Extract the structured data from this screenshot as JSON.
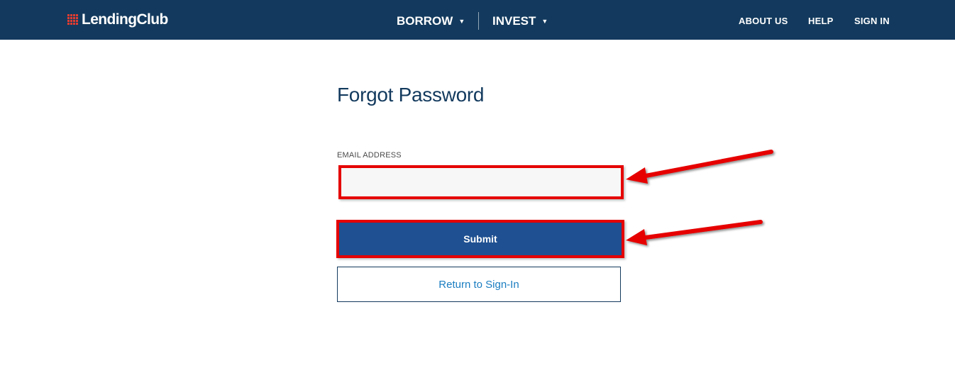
{
  "header": {
    "logo_text": "LendingClub",
    "nav_main": [
      {
        "label": "BORROW",
        "icon": "caret-down-icon"
      },
      {
        "label": "INVEST",
        "icon": "caret-down-icon"
      }
    ],
    "nav_right": [
      "ABOUT US",
      "HELP",
      "SIGN IN"
    ]
  },
  "form": {
    "title": "Forgot Password",
    "email_label": "EMAIL ADDRESS",
    "email_value": "",
    "submit_label": "Submit",
    "return_label": "Return to Sign-In"
  },
  "colors": {
    "header_bg": "#133a5e",
    "logo_red": "#e03c31",
    "title": "#133a5e",
    "primary_button": "#1f5091",
    "link": "#1a7dc1",
    "highlight": "#e60000"
  }
}
